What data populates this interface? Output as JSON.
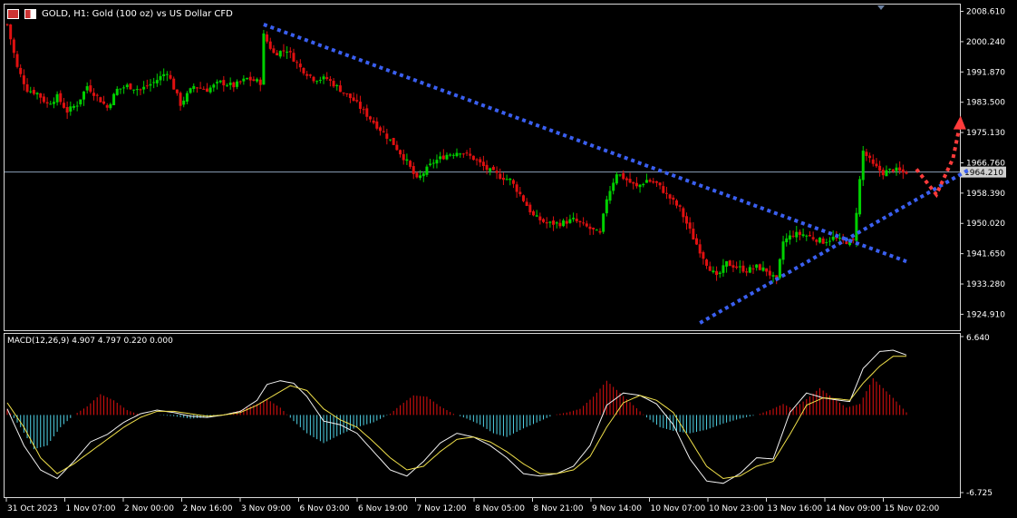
{
  "header": {
    "title": "GOLD, H1:  Gold (100 oz) vs US Dollar CFD",
    "icon_a": "window-grid-icon",
    "icon_b": "chart-type-icon"
  },
  "macd": {
    "label": "MACD(12,26,9) 4.907 4.797 0.220 0.000",
    "axis_top": "6.640",
    "axis_bottom": "-6.725"
  },
  "colors": {
    "bull": "#00d000",
    "bear": "#e01010",
    "trend": "#3a5ff0",
    "arrow": "#ff3b3b",
    "hist_pos": "#e01010",
    "hist_neg": "#4fd2e6",
    "macd_line": "#f2f2f2",
    "signal_line": "#f0e04a",
    "current_price_line": "#8ca0b8"
  },
  "chart_data": [
    {
      "type": "candlestick",
      "symbol": "GOLD",
      "timeframe": "H1",
      "current_price": 1964.21,
      "current_price_label": "1964.210",
      "y_ticks": [
        "2008.610",
        "2000.240",
        "1991.870",
        "1983.500",
        "1975.130",
        "1966.760",
        "1958.390",
        "1950.020",
        "1941.650",
        "1933.280",
        "1924.910"
      ],
      "x_ticks": [
        "31 Oct 2023",
        "1 Nov 07:00",
        "2 Nov 00:00",
        "2 Nov 16:00",
        "3 Nov 09:00",
        "6 Nov 03:00",
        "6 Nov 19:00",
        "7 Nov 12:00",
        "8 Nov 05:00",
        "8 Nov 21:00",
        "9 Nov 14:00",
        "10 Nov 07:00",
        "10 Nov 23:00",
        "13 Nov 16:00",
        "14 Nov 09:00",
        "15 Nov 02:00"
      ],
      "ylim": [
        1920.5,
        2010.5
      ],
      "close_path": [
        [
          0,
          2005
        ],
        [
          3,
          1993
        ],
        [
          6,
          1987
        ],
        [
          9,
          1986
        ],
        [
          12,
          1983
        ],
        [
          15,
          1985
        ],
        [
          18,
          1981
        ],
        [
          21,
          1983
        ],
        [
          24,
          1988
        ],
        [
          27,
          1985
        ],
        [
          30,
          1982
        ],
        [
          33,
          1987
        ],
        [
          36,
          1988
        ],
        [
          40,
          1987
        ],
        [
          44,
          1989
        ],
        [
          48,
          1992
        ],
        [
          52,
          1983
        ],
        [
          56,
          1988
        ],
        [
          60,
          1987
        ],
        [
          64,
          1989
        ],
        [
          68,
          1988
        ],
        [
          72,
          1990
        ],
        [
          76,
          1989
        ],
        [
          77,
          2002
        ],
        [
          80,
          1997
        ],
        [
          84,
          1998
        ],
        [
          88,
          1993
        ],
        [
          92,
          1990
        ],
        [
          96,
          1990
        ],
        [
          100,
          1987
        ],
        [
          104,
          1984
        ],
        [
          108,
          1980
        ],
        [
          112,
          1976
        ],
        [
          116,
          1972
        ],
        [
          120,
          1967
        ],
        [
          123,
          1962
        ],
        [
          125,
          1964
        ],
        [
          128,
          1967
        ],
        [
          132,
          1969
        ],
        [
          136,
          1970
        ],
        [
          140,
          1968
        ],
        [
          144,
          1965
        ],
        [
          148,
          1963
        ],
        [
          151,
          1962
        ],
        [
          154,
          1958
        ],
        [
          158,
          1952
        ],
        [
          162,
          1950
        ],
        [
          166,
          1950
        ],
        [
          170,
          1951
        ],
        [
          174,
          1949
        ],
        [
          178,
          1947
        ],
        [
          180,
          1957
        ],
        [
          183,
          1964
        ],
        [
          186,
          1962
        ],
        [
          189,
          1960
        ],
        [
          192,
          1962
        ],
        [
          195,
          1961
        ],
        [
          198,
          1958
        ],
        [
          202,
          1954
        ],
        [
          206,
          1946
        ],
        [
          210,
          1939
        ],
        [
          213,
          1935
        ],
        [
          216,
          1939
        ],
        [
          219,
          1938
        ],
        [
          222,
          1937
        ],
        [
          225,
          1938
        ],
        [
          228,
          1937
        ],
        [
          231,
          1934
        ],
        [
          233,
          1945
        ],
        [
          236,
          1947
        ],
        [
          239,
          1947
        ],
        [
          242,
          1946
        ],
        [
          245,
          1945
        ],
        [
          248,
          1946
        ],
        [
          251,
          1945
        ],
        [
          254,
          1945
        ],
        [
          256,
          1962
        ],
        [
          257,
          1970
        ],
        [
          260,
          1966
        ],
        [
          263,
          1964
        ],
        [
          266,
          1965
        ],
        [
          269,
          1964
        ],
        [
          270,
          1964.21
        ]
      ],
      "annotations": [
        {
          "type": "trendline",
          "label": "descending resistance",
          "from": [
            77,
            2005
          ],
          "to": [
            270,
            1939.5
          ]
        },
        {
          "type": "trendline",
          "label": "ascending support",
          "from": [
            208,
            1922.5
          ],
          "to": [
            289,
            1965
          ]
        },
        {
          "type": "arrow",
          "label": "projected bounce",
          "path": [
            [
              273,
              1965
            ],
            [
              279,
              1958
            ],
            [
              284,
              1968
            ],
            [
              286,
              1977
            ]
          ]
        }
      ]
    },
    {
      "type": "bar",
      "name": "MACD(12,26,9)",
      "values_shown": [
        4.907,
        4.797,
        0.22,
        0.0
      ],
      "ylim": [
        -6.725,
        6.64
      ],
      "macd_line": [
        [
          0,
          0.5
        ],
        [
          5,
          -2.5
        ],
        [
          10,
          -4.5
        ],
        [
          15,
          -5.2
        ],
        [
          20,
          -3.8
        ],
        [
          25,
          -2.2
        ],
        [
          30,
          -1.6
        ],
        [
          35,
          -0.6
        ],
        [
          40,
          0.1
        ],
        [
          45,
          0.4
        ],
        [
          50,
          0.2
        ],
        [
          55,
          -0.1
        ],
        [
          60,
          -0.2
        ],
        [
          65,
          0.0
        ],
        [
          70,
          0.3
        ],
        [
          75,
          1.2
        ],
        [
          78,
          2.5
        ],
        [
          82,
          2.8
        ],
        [
          86,
          2.6
        ],
        [
          90,
          1.5
        ],
        [
          95,
          -0.5
        ],
        [
          100,
          -0.8
        ],
        [
          105,
          -1.5
        ],
        [
          110,
          -3.0
        ],
        [
          115,
          -4.5
        ],
        [
          120,
          -5.0
        ],
        [
          125,
          -3.8
        ],
        [
          130,
          -2.3
        ],
        [
          135,
          -1.5
        ],
        [
          140,
          -1.8
        ],
        [
          145,
          -2.5
        ],
        [
          150,
          -3.5
        ],
        [
          155,
          -4.8
        ],
        [
          160,
          -5.0
        ],
        [
          165,
          -4.8
        ],
        [
          170,
          -4.2
        ],
        [
          175,
          -2.5
        ],
        [
          180,
          0.8
        ],
        [
          185,
          1.8
        ],
        [
          190,
          1.6
        ],
        [
          195,
          0.9
        ],
        [
          200,
          -0.8
        ],
        [
          205,
          -3.6
        ],
        [
          210,
          -5.4
        ],
        [
          215,
          -5.6
        ],
        [
          220,
          -4.8
        ],
        [
          225,
          -3.5
        ],
        [
          230,
          -3.6
        ],
        [
          235,
          0.2
        ],
        [
          240,
          1.8
        ],
        [
          245,
          1.4
        ],
        [
          250,
          1.2
        ],
        [
          253,
          1.1
        ],
        [
          257,
          3.8
        ],
        [
          262,
          5.2
        ],
        [
          266,
          5.3
        ],
        [
          270,
          4.907
        ]
      ],
      "signal_line": [
        [
          0,
          1.0
        ],
        [
          5,
          -1.0
        ],
        [
          10,
          -3.5
        ],
        [
          15,
          -4.8
        ],
        [
          20,
          -4.0
        ],
        [
          25,
          -3.0
        ],
        [
          30,
          -2.0
        ],
        [
          35,
          -1.0
        ],
        [
          40,
          -0.2
        ],
        [
          45,
          0.3
        ],
        [
          50,
          0.3
        ],
        [
          55,
          0.1
        ],
        [
          60,
          -0.1
        ],
        [
          65,
          0.0
        ],
        [
          70,
          0.2
        ],
        [
          75,
          0.8
        ],
        [
          80,
          1.6
        ],
        [
          85,
          2.4
        ],
        [
          90,
          2.0
        ],
        [
          95,
          0.5
        ],
        [
          100,
          -0.4
        ],
        [
          105,
          -1.0
        ],
        [
          110,
          -2.2
        ],
        [
          115,
          -3.5
        ],
        [
          120,
          -4.5
        ],
        [
          125,
          -4.2
        ],
        [
          130,
          -3.0
        ],
        [
          135,
          -2.0
        ],
        [
          140,
          -1.8
        ],
        [
          145,
          -2.2
        ],
        [
          150,
          -3.0
        ],
        [
          155,
          -4.0
        ],
        [
          160,
          -4.8
        ],
        [
          165,
          -4.8
        ],
        [
          170,
          -4.5
        ],
        [
          175,
          -3.4
        ],
        [
          180,
          -1.0
        ],
        [
          185,
          1.0
        ],
        [
          190,
          1.6
        ],
        [
          195,
          1.2
        ],
        [
          200,
          0.2
        ],
        [
          205,
          -2.0
        ],
        [
          210,
          -4.2
        ],
        [
          215,
          -5.2
        ],
        [
          220,
          -5.0
        ],
        [
          225,
          -4.2
        ],
        [
          230,
          -3.8
        ],
        [
          235,
          -1.6
        ],
        [
          240,
          0.8
        ],
        [
          245,
          1.4
        ],
        [
          250,
          1.3
        ],
        [
          253,
          1.2
        ],
        [
          257,
          2.6
        ],
        [
          262,
          4.0
        ],
        [
          266,
          4.8
        ],
        [
          270,
          4.797
        ]
      ],
      "histogram": [
        [
          0,
          0.5
        ],
        [
          4,
          -1.0
        ],
        [
          8,
          -2.8
        ],
        [
          12,
          -2.5
        ],
        [
          16,
          -1.0
        ],
        [
          20,
          0.0
        ],
        [
          24,
          0.7
        ],
        [
          28,
          1.7
        ],
        [
          32,
          1.2
        ],
        [
          36,
          0.4
        ],
        [
          40,
          0.0
        ],
        [
          45,
          0.0
        ],
        [
          50,
          -0.1
        ],
        [
          55,
          -0.3
        ],
        [
          60,
          -0.2
        ],
        [
          65,
          0.0
        ],
        [
          70,
          0.4
        ],
        [
          75,
          0.9
        ],
        [
          78,
          1.3
        ],
        [
          82,
          0.6
        ],
        [
          86,
          -0.5
        ],
        [
          90,
          -1.5
        ],
        [
          95,
          -2.3
        ],
        [
          100,
          -1.6
        ],
        [
          105,
          -1.0
        ],
        [
          110,
          -0.6
        ],
        [
          115,
          0.1
        ],
        [
          118,
          0.8
        ],
        [
          122,
          1.6
        ],
        [
          126,
          1.5
        ],
        [
          130,
          0.7
        ],
        [
          134,
          0.1
        ],
        [
          138,
          -0.3
        ],
        [
          142,
          -0.8
        ],
        [
          146,
          -1.5
        ],
        [
          150,
          -1.8
        ],
        [
          155,
          -1.1
        ],
        [
          160,
          -0.5
        ],
        [
          164,
          0.0
        ],
        [
          168,
          0.2
        ],
        [
          172,
          0.5
        ],
        [
          176,
          1.5
        ],
        [
          180,
          2.8
        ],
        [
          184,
          1.8
        ],
        [
          188,
          0.8
        ],
        [
          192,
          -0.2
        ],
        [
          196,
          -1.0
        ],
        [
          200,
          -1.3
        ],
        [
          205,
          -1.5
        ],
        [
          210,
          -1.2
        ],
        [
          215,
          -0.7
        ],
        [
          220,
          -0.3
        ],
        [
          225,
          0.0
        ],
        [
          229,
          0.4
        ],
        [
          233,
          0.9
        ],
        [
          236,
          0.5
        ],
        [
          240,
          1.3
        ],
        [
          244,
          2.2
        ],
        [
          248,
          1.4
        ],
        [
          252,
          0.6
        ],
        [
          256,
          0.9
        ],
        [
          260,
          3.0
        ],
        [
          263,
          2.2
        ],
        [
          266,
          1.4
        ],
        [
          270,
          0.22
        ]
      ]
    }
  ]
}
